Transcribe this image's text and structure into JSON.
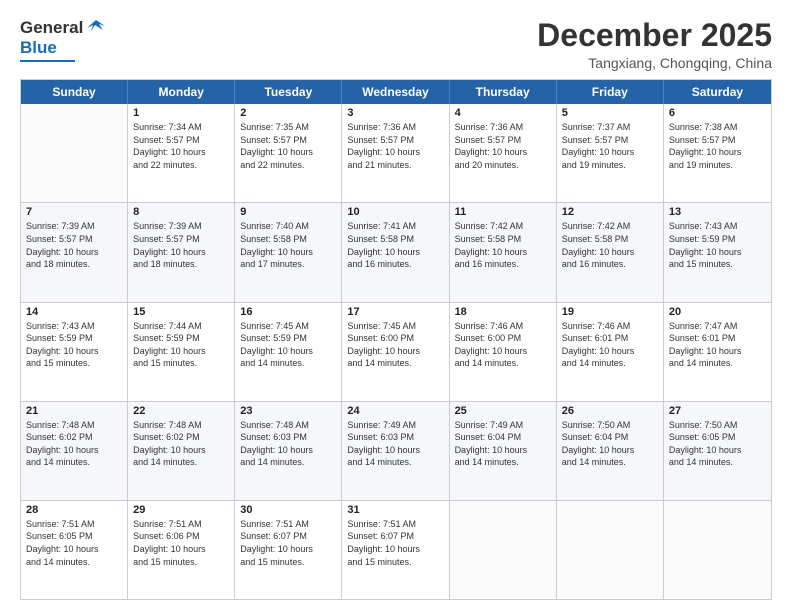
{
  "logo": {
    "general": "General",
    "blue": "Blue"
  },
  "title": "December 2025",
  "subtitle": "Tangxiang, Chongqing, China",
  "headers": [
    "Sunday",
    "Monday",
    "Tuesday",
    "Wednesday",
    "Thursday",
    "Friday",
    "Saturday"
  ],
  "rows": [
    [
      {
        "day": "",
        "info": ""
      },
      {
        "day": "1",
        "info": "Sunrise: 7:34 AM\nSunset: 5:57 PM\nDaylight: 10 hours\nand 22 minutes."
      },
      {
        "day": "2",
        "info": "Sunrise: 7:35 AM\nSunset: 5:57 PM\nDaylight: 10 hours\nand 22 minutes."
      },
      {
        "day": "3",
        "info": "Sunrise: 7:36 AM\nSunset: 5:57 PM\nDaylight: 10 hours\nand 21 minutes."
      },
      {
        "day": "4",
        "info": "Sunrise: 7:36 AM\nSunset: 5:57 PM\nDaylight: 10 hours\nand 20 minutes."
      },
      {
        "day": "5",
        "info": "Sunrise: 7:37 AM\nSunset: 5:57 PM\nDaylight: 10 hours\nand 19 minutes."
      },
      {
        "day": "6",
        "info": "Sunrise: 7:38 AM\nSunset: 5:57 PM\nDaylight: 10 hours\nand 19 minutes."
      }
    ],
    [
      {
        "day": "7",
        "info": "Sunrise: 7:39 AM\nSunset: 5:57 PM\nDaylight: 10 hours\nand 18 minutes."
      },
      {
        "day": "8",
        "info": "Sunrise: 7:39 AM\nSunset: 5:57 PM\nDaylight: 10 hours\nand 18 minutes."
      },
      {
        "day": "9",
        "info": "Sunrise: 7:40 AM\nSunset: 5:58 PM\nDaylight: 10 hours\nand 17 minutes."
      },
      {
        "day": "10",
        "info": "Sunrise: 7:41 AM\nSunset: 5:58 PM\nDaylight: 10 hours\nand 16 minutes."
      },
      {
        "day": "11",
        "info": "Sunrise: 7:42 AM\nSunset: 5:58 PM\nDaylight: 10 hours\nand 16 minutes."
      },
      {
        "day": "12",
        "info": "Sunrise: 7:42 AM\nSunset: 5:58 PM\nDaylight: 10 hours\nand 16 minutes."
      },
      {
        "day": "13",
        "info": "Sunrise: 7:43 AM\nSunset: 5:59 PM\nDaylight: 10 hours\nand 15 minutes."
      }
    ],
    [
      {
        "day": "14",
        "info": "Sunrise: 7:43 AM\nSunset: 5:59 PM\nDaylight: 10 hours\nand 15 minutes."
      },
      {
        "day": "15",
        "info": "Sunrise: 7:44 AM\nSunset: 5:59 PM\nDaylight: 10 hours\nand 15 minutes."
      },
      {
        "day": "16",
        "info": "Sunrise: 7:45 AM\nSunset: 5:59 PM\nDaylight: 10 hours\nand 14 minutes."
      },
      {
        "day": "17",
        "info": "Sunrise: 7:45 AM\nSunset: 6:00 PM\nDaylight: 10 hours\nand 14 minutes."
      },
      {
        "day": "18",
        "info": "Sunrise: 7:46 AM\nSunset: 6:00 PM\nDaylight: 10 hours\nand 14 minutes."
      },
      {
        "day": "19",
        "info": "Sunrise: 7:46 AM\nSunset: 6:01 PM\nDaylight: 10 hours\nand 14 minutes."
      },
      {
        "day": "20",
        "info": "Sunrise: 7:47 AM\nSunset: 6:01 PM\nDaylight: 10 hours\nand 14 minutes."
      }
    ],
    [
      {
        "day": "21",
        "info": "Sunrise: 7:48 AM\nSunset: 6:02 PM\nDaylight: 10 hours\nand 14 minutes."
      },
      {
        "day": "22",
        "info": "Sunrise: 7:48 AM\nSunset: 6:02 PM\nDaylight: 10 hours\nand 14 minutes."
      },
      {
        "day": "23",
        "info": "Sunrise: 7:48 AM\nSunset: 6:03 PM\nDaylight: 10 hours\nand 14 minutes."
      },
      {
        "day": "24",
        "info": "Sunrise: 7:49 AM\nSunset: 6:03 PM\nDaylight: 10 hours\nand 14 minutes."
      },
      {
        "day": "25",
        "info": "Sunrise: 7:49 AM\nSunset: 6:04 PM\nDaylight: 10 hours\nand 14 minutes."
      },
      {
        "day": "26",
        "info": "Sunrise: 7:50 AM\nSunset: 6:04 PM\nDaylight: 10 hours\nand 14 minutes."
      },
      {
        "day": "27",
        "info": "Sunrise: 7:50 AM\nSunset: 6:05 PM\nDaylight: 10 hours\nand 14 minutes."
      }
    ],
    [
      {
        "day": "28",
        "info": "Sunrise: 7:51 AM\nSunset: 6:05 PM\nDaylight: 10 hours\nand 14 minutes."
      },
      {
        "day": "29",
        "info": "Sunrise: 7:51 AM\nSunset: 6:06 PM\nDaylight: 10 hours\nand 15 minutes."
      },
      {
        "day": "30",
        "info": "Sunrise: 7:51 AM\nSunset: 6:07 PM\nDaylight: 10 hours\nand 15 minutes."
      },
      {
        "day": "31",
        "info": "Sunrise: 7:51 AM\nSunset: 6:07 PM\nDaylight: 10 hours\nand 15 minutes."
      },
      {
        "day": "",
        "info": ""
      },
      {
        "day": "",
        "info": ""
      },
      {
        "day": "",
        "info": ""
      }
    ]
  ]
}
